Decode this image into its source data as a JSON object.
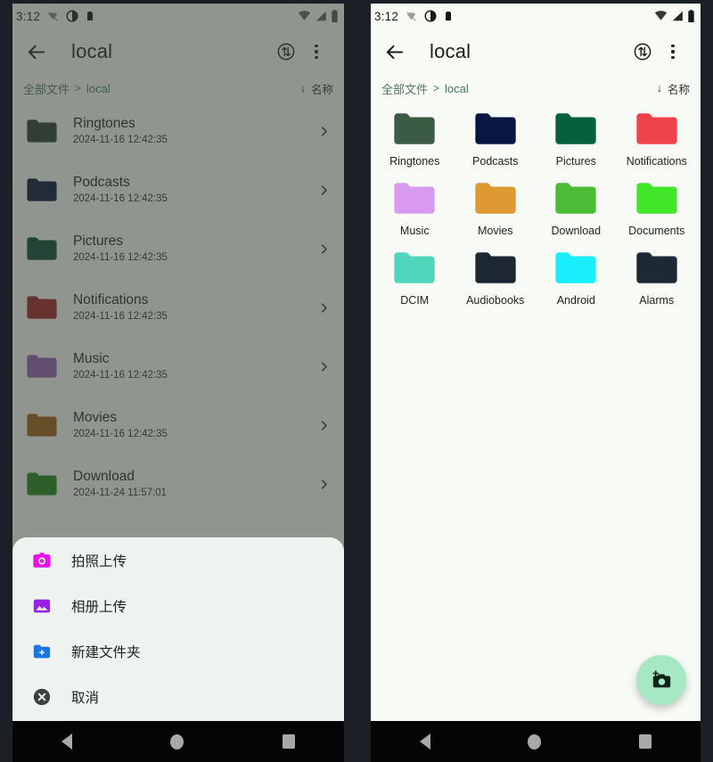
{
  "status_bar": {
    "time": "3:12",
    "left_icons": [
      "wifi-off-icon",
      "do-not-disturb-icon",
      "battery-saver-icon"
    ],
    "right_icons": [
      "wifi-icon",
      "signal-icon",
      "battery-icon"
    ]
  },
  "toolbar": {
    "back_label": "back",
    "title": "local",
    "transfer_icon": "transfer-circle-icon",
    "overflow_label": "more options"
  },
  "breadcrumb": {
    "root": "全部文件",
    "separator": ">",
    "current": "local",
    "sort_label": "名称",
    "sort_arrow": "↓"
  },
  "left_panel": {
    "view": "list",
    "rows": [
      {
        "name": "Ringtones",
        "time": "2024-11-16 12:42:35",
        "color": "#223b28"
      },
      {
        "name": "Podcasts",
        "time": "2024-11-16 12:42:35",
        "color": "#050f33"
      },
      {
        "name": "Pictures",
        "time": "2024-11-16 12:42:35",
        "color": "#044730"
      },
      {
        "name": "Notifications",
        "time": "2024-11-16 12:42:35",
        "color": "#9e1f24"
      },
      {
        "name": "Music",
        "time": "2024-11-16 12:42:35",
        "color": "#8e5cab"
      },
      {
        "name": "Movies",
        "time": "2024-11-16 12:42:35",
        "color": "#9a6110"
      },
      {
        "name": "Download",
        "time": "2024-11-24 11:57:01",
        "color": "#1e8216"
      }
    ],
    "sheet": {
      "items": [
        {
          "label": "拍照上传",
          "icon": "camera-icon",
          "color": "#e811e8"
        },
        {
          "label": "相册上传",
          "icon": "photo-icon",
          "color": "#9b1fe8"
        },
        {
          "label": "新建文件夹",
          "icon": "new-folder-icon",
          "color": "#1b74e4"
        },
        {
          "label": "取消",
          "icon": "cancel-icon",
          "color": "#3c4043"
        }
      ]
    }
  },
  "right_panel": {
    "view": "grid",
    "items": [
      {
        "name": "Ringtones",
        "color": "#3b5b45"
      },
      {
        "name": "Podcasts",
        "color": "#071643"
      },
      {
        "name": "Pictures",
        "color": "#06603d"
      },
      {
        "name": "Notifications",
        "color": "#f0424a"
      },
      {
        "name": "Music",
        "color": "#d99bf0"
      },
      {
        "name": "Movies",
        "color": "#dd9a33"
      },
      {
        "name": "Download",
        "color": "#4cbb36"
      },
      {
        "name": "Documents",
        "color": "#42e52a"
      },
      {
        "name": "DCIM",
        "color": "#4fd6bb"
      },
      {
        "name": "Audiobooks",
        "color": "#1d2733"
      },
      {
        "name": "Android",
        "color": "#18eefc"
      },
      {
        "name": "Alarms",
        "color": "#1d2a35"
      }
    ],
    "fab": {
      "icon": "add-photo-icon",
      "color": "#a6e8c4"
    }
  },
  "nav_bar": {
    "back": "back",
    "home": "home",
    "recents": "recents"
  },
  "colors": {
    "app_background": "#f7faf5",
    "scrim": "#6e716e",
    "sheet_background": "#eff3ef",
    "breadcrumb_link": "#4e7a5e",
    "fab": "#a6e8c4"
  }
}
